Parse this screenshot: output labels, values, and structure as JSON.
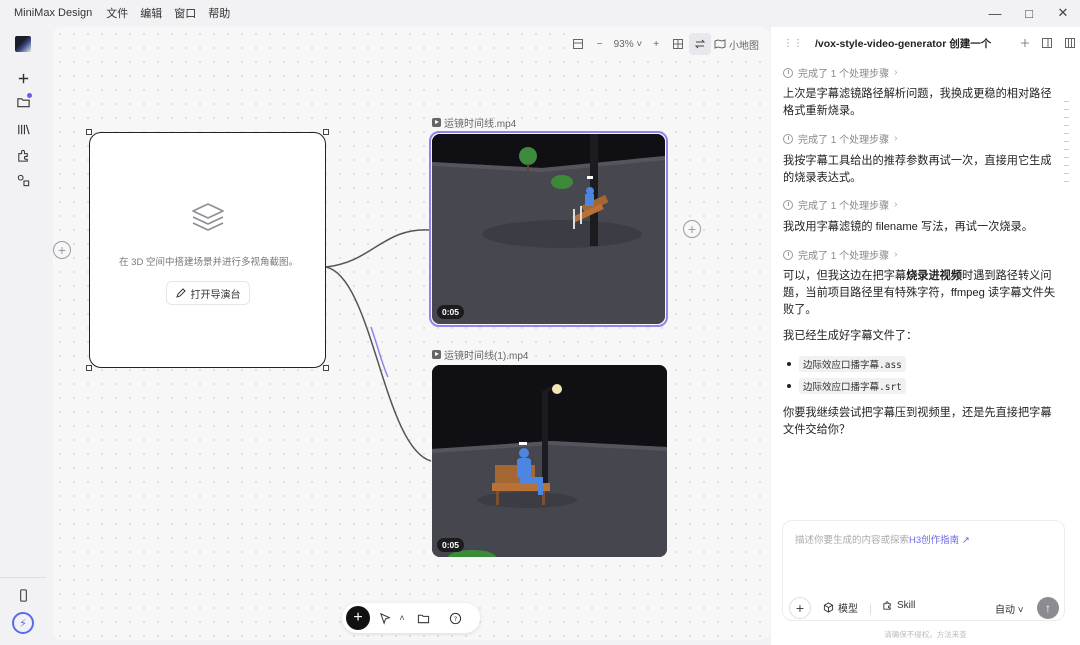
{
  "app": {
    "name": "MiniMax Design",
    "menu": [
      "文件",
      "编辑",
      "窗口",
      "帮助"
    ]
  },
  "canvas": {
    "toolbar": {
      "zoom": "93%",
      "minimap_label": "小地图"
    },
    "node": {
      "description": "在 3D 空间中搭建场景并进行多视角截图。",
      "open_button": "打开导演台"
    },
    "videos": [
      {
        "filename": "运镜时间线.mp4",
        "timecode": "0:05"
      },
      {
        "filename": "运镜时间线(1).mp4",
        "timecode": "0:05"
      }
    ]
  },
  "chat": {
    "title": "/vox-style-video-generator 创建一个口播...",
    "step_label": "完成了 1 个处理步骤",
    "messages": [
      "上次是字幕滤镜路径解析问题，我换成更稳的相对路径格式重新烧录。",
      "我按字幕工具给出的推荐参数再试一次，直接用它生成的烧录表达式。",
      "我改用字幕滤镜的 filename 写法，再试一次烧录。"
    ],
    "msg4": {
      "pre": "可以，但我这边在把字幕",
      "bold": "烧录进视频",
      "post": "时遇到路径转义问题，当前项目路径里有特殊字符，ffmpeg 读字幕文件失败了。"
    },
    "files_intro": "我已经生成好字幕文件了：",
    "files": [
      "边际效应口播字幕.ass",
      "边际效应口播字幕.srt"
    ],
    "question": "你要我继续尝试把字幕压到视频里，还是先直接把字幕文件交给你？",
    "composer": {
      "placeholder": "描述你要生成的内容或探索",
      "link": "H3创作指南 ↗",
      "model_label": "模型",
      "skill_label": "Skill",
      "auto_label": "自动"
    },
    "footer": "请确保不侵权。方法来查"
  }
}
